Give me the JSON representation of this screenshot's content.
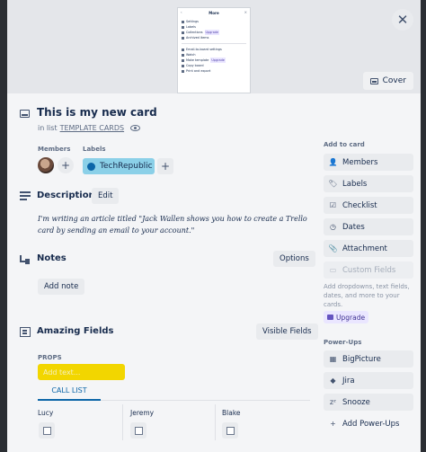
{
  "cover_preview": {
    "title": "More",
    "items_top": [
      "Settings",
      "Labels",
      "Collections",
      "Archived items"
    ],
    "collections_badge": "Upgrade",
    "items_bottom": [
      "Email-to-board settings",
      "Watch",
      "Make template",
      "Copy board",
      "Print and export"
    ],
    "template_badge": "Upgrade"
  },
  "cover_button": "Cover",
  "card": {
    "title": "This is my new card",
    "in_list_prefix": "in list",
    "list_name": "TEMPLATE CARDS"
  },
  "members": {
    "label": "Members"
  },
  "labels": {
    "label": "Labels",
    "chip_text": "TechRepublic",
    "chip_color": "#8bd0e8",
    "dot_color": "#0c66a8"
  },
  "description": {
    "title": "Description",
    "edit_label": "Edit",
    "text": "I'm writing an article titled \"Jack Wallen shows you how to create a Trello card by sending an email to your account.\""
  },
  "notes": {
    "title": "Notes",
    "options_label": "Options",
    "add_note_label": "Add note"
  },
  "amazing_fields": {
    "title": "Amazing Fields",
    "visible_fields_label": "Visible Fields",
    "props_label": "PROPS",
    "props_placeholder": "Add text...",
    "props_color": "#f2d600",
    "tab_label": "CALL LIST",
    "columns": [
      "Lucy",
      "Jeremy",
      "Blake"
    ]
  },
  "sidebar": {
    "add_to_card_label": "Add to card",
    "buttons": [
      {
        "label": "Members",
        "icon": "person-icon"
      },
      {
        "label": "Labels",
        "icon": "tag-icon"
      },
      {
        "label": "Checklist",
        "icon": "checklist-icon"
      },
      {
        "label": "Dates",
        "icon": "clock-icon"
      },
      {
        "label": "Attachment",
        "icon": "paperclip-icon"
      },
      {
        "label": "Custom Fields",
        "icon": "custom-fields-icon"
      }
    ],
    "custom_fields_note": "Add dropdowns, text fields, dates, and more to your cards.",
    "upgrade_label": "Upgrade",
    "power_ups_label": "Power-Ups",
    "power_ups": [
      {
        "label": "BigPicture",
        "icon": "bigpicture-icon"
      },
      {
        "label": "Jira",
        "icon": "jira-icon"
      },
      {
        "label": "Snooze",
        "icon": "snooze-icon"
      }
    ],
    "add_power_ups_label": "Add Power-Ups"
  }
}
